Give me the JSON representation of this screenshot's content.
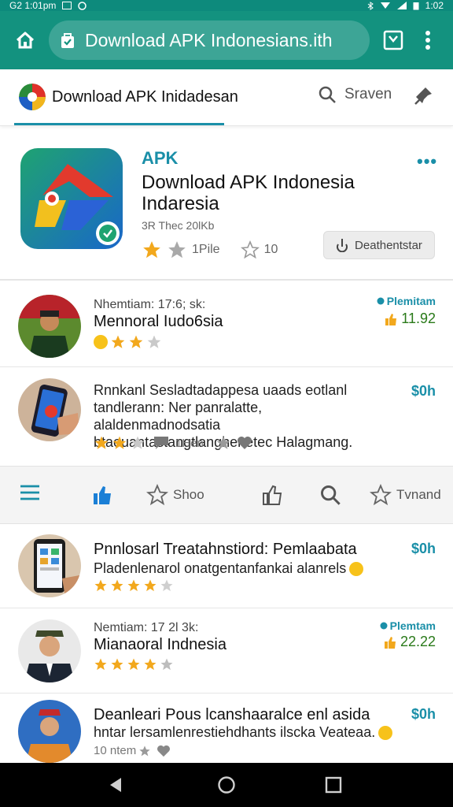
{
  "status_bar": {
    "left_text": "G2 1:01pm",
    "right_text": "1:02"
  },
  "browser": {
    "url": "Download APK Indonesians.ith"
  },
  "site_header": {
    "name": "Download APK Inidadesan",
    "search_label": "Sraven"
  },
  "app": {
    "tag": "APK",
    "title_line1": "Download APK Indonesia",
    "title_line2": "Indaresia",
    "subtitle": "3R Thec 20lKb",
    "rating_label": "1Pile",
    "votes": "10",
    "download_label": "Deathentstar"
  },
  "items": [
    {
      "meta": "Nhemtiam: 17:6; sk:",
      "title": "Mennoral Iudo6sia",
      "badge": "Plemitam",
      "score": "11.92"
    },
    {
      "desc": "Rnnkanl Sesladtadappesa uaads eotlanl tandlerann: Ner panralatte, alaldenmadnodsatia btaouantastangtlanghenetec Halagmang.",
      "price": "$0h",
      "reviews": "1Hen"
    },
    {
      "desc_title": "Pnnlosarl Treatahnstiord: Pemlaabata",
      "desc_sub": "Pladenlenarol onatgentanfankai alanrels",
      "price": "$0h"
    },
    {
      "meta": "Nemtiam: 17 2l 3k:",
      "title": "Mianaoral Indnesia",
      "badge": "Plemtam",
      "score": "22.22"
    },
    {
      "desc_title": "Deanleari Pous lcanshaaralce enl asida",
      "desc_sub": "hntar lersamlenrestiehdhants ilscka Veateaa.",
      "price": "$0h",
      "reviews": "10 ntem"
    }
  ],
  "tabs": {
    "home": "Shoo",
    "trend": "Tvnand"
  },
  "colors": {
    "primary": "#13927f",
    "accent": "#1a8fa8",
    "star": "#f2a81d"
  }
}
